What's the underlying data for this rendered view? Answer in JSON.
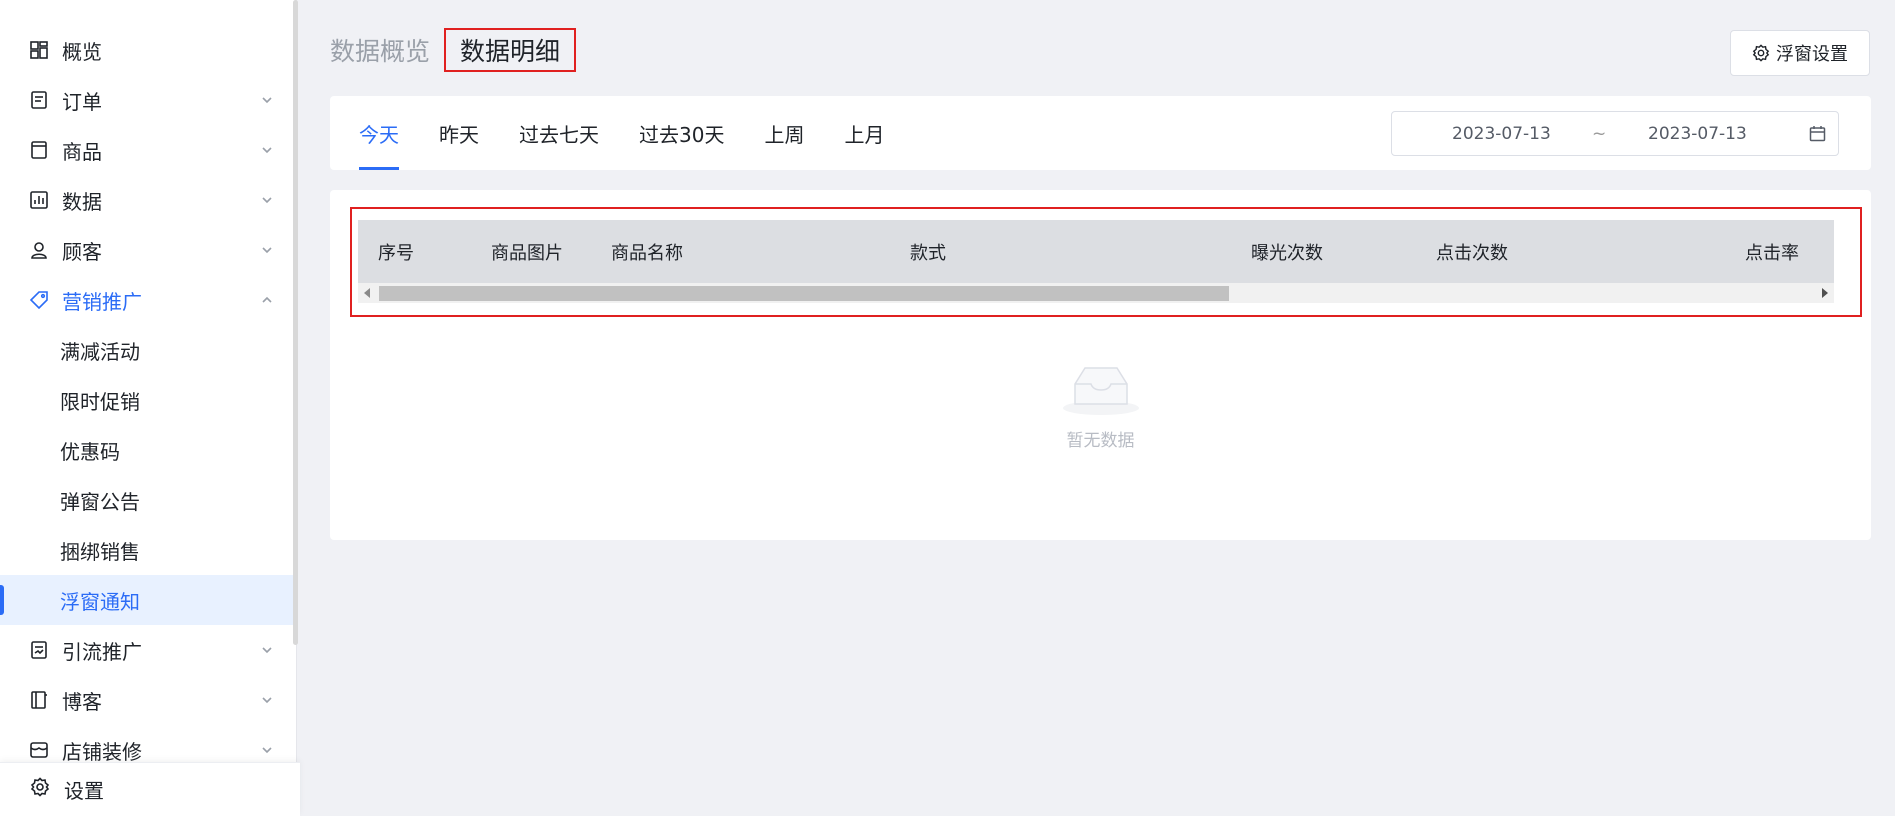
{
  "sidebar": {
    "items": [
      {
        "label": "概览",
        "icon": "dashboard-icon"
      },
      {
        "label": "订单",
        "icon": "order-icon",
        "expandable": true
      },
      {
        "label": "商品",
        "icon": "product-icon",
        "expandable": true
      },
      {
        "label": "数据",
        "icon": "chart-icon",
        "expandable": true
      },
      {
        "label": "顾客",
        "icon": "user-icon",
        "expandable": true
      },
      {
        "label": "营销推广",
        "icon": "tag-icon",
        "expandable": true,
        "expanded": true
      },
      {
        "label": "满减活动"
      },
      {
        "label": "限时促销"
      },
      {
        "label": "优惠码"
      },
      {
        "label": "弹窗公告"
      },
      {
        "label": "捆绑销售"
      },
      {
        "label": "浮窗通知",
        "selected": true
      },
      {
        "label": "引流推广",
        "icon": "traffic-icon",
        "expandable": true
      },
      {
        "label": "博客",
        "icon": "blog-icon",
        "expandable": true
      },
      {
        "label": "店铺装修",
        "icon": "store-icon",
        "expandable": true
      }
    ],
    "settings_label": "设置"
  },
  "header": {
    "tab_overview": "数据概览",
    "tab_detail": "数据明细",
    "float_settings_label": "浮窗设置"
  },
  "filter": {
    "ranges": [
      "今天",
      "昨天",
      "过去七天",
      "过去30天",
      "上周",
      "上月"
    ],
    "active_range": "今天",
    "start_date": "2023-07-13",
    "separator": "~",
    "end_date": "2023-07-13"
  },
  "table": {
    "columns": [
      "序号",
      "商品图片",
      "商品名称",
      "款式",
      "曝光次数",
      "点击次数",
      "点击率"
    ],
    "empty_text": "暂无数据"
  },
  "colors": {
    "accent": "#2b6cf6",
    "highlight": "#e02020",
    "background": "#f0f1f5"
  }
}
